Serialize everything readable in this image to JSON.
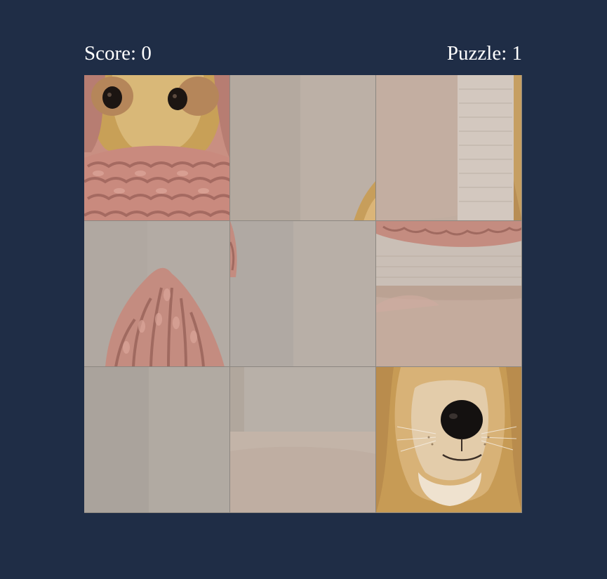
{
  "hud": {
    "score_label": "Score: 0",
    "puzzle_label": "Puzzle: 1"
  },
  "puzzle": {
    "grid_rows": 3,
    "grid_cols": 3,
    "tiles": [
      {
        "position": 1,
        "content": "dog eyes and forehead above pink knitted hood"
      },
      {
        "position": 2,
        "content": "beige background with fur edge"
      },
      {
        "position": 3,
        "content": "beige background with light panel"
      },
      {
        "position": 4,
        "content": "top of pink knitted hat"
      },
      {
        "position": 5,
        "content": "beige background"
      },
      {
        "position": 6,
        "content": "knit edge over beige background"
      },
      {
        "position": 7,
        "content": "beige background"
      },
      {
        "position": 8,
        "content": "beige background"
      },
      {
        "position": 9,
        "content": "dog snout and black nose"
      }
    ]
  },
  "colors": {
    "page_background": "#1f2d46",
    "hud_text": "#ffffff",
    "knit_pink": "#c98c80",
    "dog_fur": "#c9a35e",
    "beige_bg": "#b3aaa2"
  }
}
